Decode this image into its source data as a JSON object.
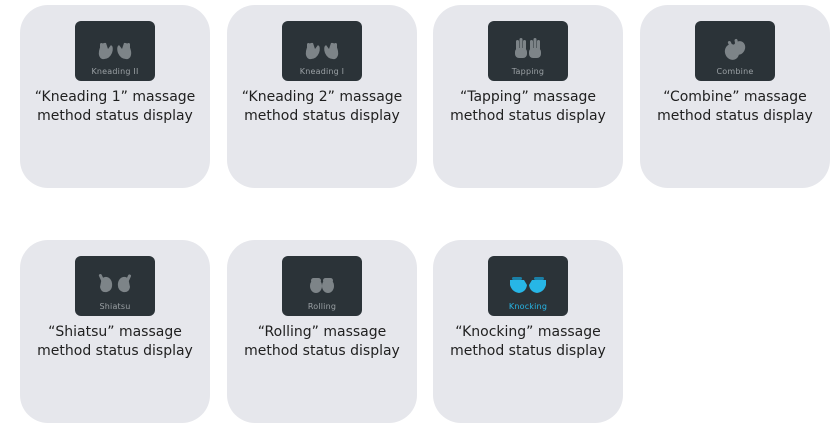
{
  "cards": [
    {
      "tile_label": "Kneading II",
      "icon": "kneading-hands-icon",
      "caption_line1": "“Kneading 1” massage",
      "caption_line2": "method status display",
      "active": false
    },
    {
      "tile_label": "Kneading I",
      "icon": "kneading-hands-icon",
      "caption_line1": "“Kneading 2” massage",
      "caption_line2": "method status display",
      "active": false
    },
    {
      "tile_label": "Tapping",
      "icon": "tapping-hands-icon",
      "caption_line1": "“Tapping” massage",
      "caption_line2": "method status display",
      "active": false
    },
    {
      "tile_label": "Combine",
      "icon": "combine-hands-icon",
      "caption_line1": "“Combine” massage",
      "caption_line2": "method status display",
      "active": false
    },
    {
      "tile_label": "Shiatsu",
      "icon": "shiatsu-hands-icon",
      "caption_line1": "“Shiatsu” massage",
      "caption_line2": "method status display",
      "active": false
    },
    {
      "tile_label": "Rolling",
      "icon": "rolling-hands-icon",
      "caption_line1": "“Rolling” massage",
      "caption_line2": "method status display",
      "active": false
    },
    {
      "tile_label": "Knocking",
      "icon": "knocking-hands-icon",
      "caption_line1": "“Knocking” massage",
      "caption_line2": "method status display",
      "active": true
    }
  ],
  "colors": {
    "card_bg": "#e6e7ec",
    "tile_bg": "#2b3338",
    "icon_inactive": "#7d8488",
    "icon_active": "#27b6e6"
  }
}
